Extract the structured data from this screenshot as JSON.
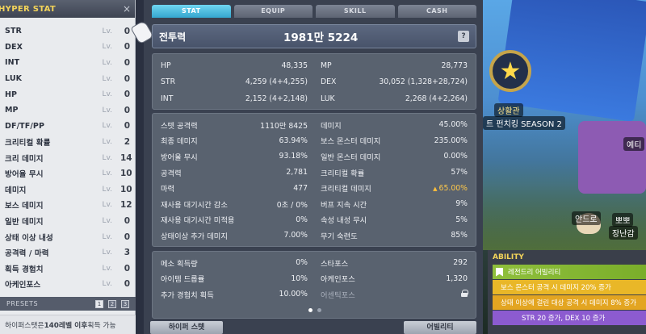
{
  "hyper": {
    "title": "HYPER STAT",
    "close": "×",
    "lv_label": "Lv.",
    "stats": [
      {
        "name": "STR",
        "value": "0"
      },
      {
        "name": "DEX",
        "value": "0"
      },
      {
        "name": "INT",
        "value": "0"
      },
      {
        "name": "LUK",
        "value": "0"
      },
      {
        "name": "HP",
        "value": "0"
      },
      {
        "name": "MP",
        "value": "0"
      },
      {
        "name": "DF/TF/PP",
        "value": "0"
      },
      {
        "name": "크리티컬 확률",
        "value": "2"
      },
      {
        "name": "크리 데미지",
        "value": "14"
      },
      {
        "name": "방어율 무시",
        "value": "10"
      },
      {
        "name": "데미지",
        "value": "10"
      },
      {
        "name": "보스 데미지",
        "value": "12"
      },
      {
        "name": "일반 데미지",
        "value": "0"
      },
      {
        "name": "상태 이상 내성",
        "value": "0"
      },
      {
        "name": "공격력 / 마력",
        "value": "3"
      },
      {
        "name": "획득 경험치",
        "value": "0"
      },
      {
        "name": "아케인포스",
        "value": "0"
      }
    ],
    "presets_label": "PRESETS",
    "presets": [
      "1",
      "2",
      "3"
    ],
    "active_preset": 0,
    "note_prefix": "하이퍼스탯은 ",
    "note_bold": "140레벨 이후",
    "note_suffix": " 획득 가능"
  },
  "tabs": [
    "STAT",
    "EQUIP",
    "SKILL",
    "CASH"
  ],
  "active_tab": 0,
  "combat_power": {
    "label": "전투력",
    "value": "1981만 5224",
    "help": "?"
  },
  "basic": [
    {
      "k": "HP",
      "v": "48,335"
    },
    {
      "k": "MP",
      "v": "28,773"
    },
    {
      "k": "STR",
      "v": "4,259 (4+4,255)"
    },
    {
      "k": "DEX",
      "v": "30,052 (1,328+28,724)"
    },
    {
      "k": "INT",
      "v": "2,152 (4+2,148)"
    },
    {
      "k": "LUK",
      "v": "2,268 (4+2,264)"
    }
  ],
  "detail": [
    {
      "k": "스텟 공격력",
      "v": "1110만 8425"
    },
    {
      "k": "데미지",
      "v": "45.00%"
    },
    {
      "k": "최종 데미지",
      "v": "63.94%"
    },
    {
      "k": "보스 몬스터 데미지",
      "v": "235.00%"
    },
    {
      "k": "방어율 무시",
      "v": "93.18%"
    },
    {
      "k": "일반 몬스터 데미지",
      "v": "0.00%"
    },
    {
      "k": "공격력",
      "v": "2,781"
    },
    {
      "k": "크리티컬 확률",
      "v": "57%"
    },
    {
      "k": "마력",
      "v": "477"
    },
    {
      "k": "크리티컬 데미지",
      "v": "65.00%",
      "up": "▲",
      "gold": true
    },
    {
      "k": "재사용 대기시간 감소",
      "v": "0초 / 0%"
    },
    {
      "k": "버프 지속 시간",
      "v": "9%"
    },
    {
      "k": "재사용 대기시간 미적용",
      "v": "0%"
    },
    {
      "k": "속성 내성 무시",
      "v": "5%"
    },
    {
      "k": "상태이상 추가 데미지",
      "v": "7.00%"
    },
    {
      "k": "무기 숙련도",
      "v": "85%"
    }
  ],
  "extra": [
    {
      "k": "메소 획득량",
      "v": "0%"
    },
    {
      "k": "스타포스",
      "v": "292"
    },
    {
      "k": "아이템 드롭률",
      "v": "10%"
    },
    {
      "k": "아케인포스",
      "v": "1,320"
    },
    {
      "k": "추가 경험치 획득",
      "v": "10.00%"
    },
    {
      "k": "어센틱포스",
      "v": "",
      "locked": true
    }
  ],
  "page_dots": 2,
  "bottom": {
    "hyper_btn": "하이퍼 스텟",
    "ability_btn": "어빌리티"
  },
  "ability": {
    "title": "ABILITY",
    "rank": "레전드리 어빌리티",
    "lines": [
      "보스 몬스터 공격 시 데미지 20% 증가",
      "상태 이상에 걸린 대상 공격 시 데미지 8% 증가",
      "STR 20 증가, DEX 10 증가"
    ]
  },
  "scene": {
    "labels": [
      "상활관",
      "트 펀치킹 SEASON 2",
      "예티",
      "안드로",
      "뽀뽀",
      "장난감"
    ]
  }
}
